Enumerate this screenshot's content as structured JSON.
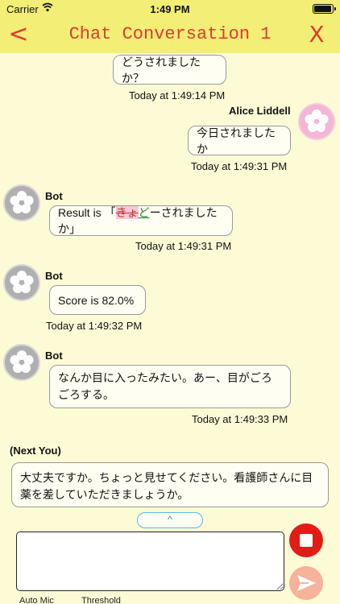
{
  "status_bar": {
    "carrier": "Carrier",
    "time": "1:49 PM",
    "battery_level": 0.95
  },
  "nav": {
    "back": "<",
    "title": "Chat Conversation 1",
    "close": "X"
  },
  "messages": [
    {
      "text": "どうされましたか？",
      "timestamp": "Today at 1:49:14 PM"
    },
    {
      "sender": "Alice Liddell",
      "text": "今日されましたか",
      "timestamp": "Today at 1:49:31 PM"
    },
    {
      "sender": "Bot",
      "prefix": "Result is 「",
      "struck": "きょ",
      "inserted": "ど",
      "suffix": "ーされましたか」",
      "timestamp": "Today at 1:49:31 PM"
    },
    {
      "sender": "Bot",
      "text": "Score is 82.0%",
      "timestamp": "Today at 1:49:32 PM"
    },
    {
      "sender": "Bot",
      "text": "なんか目に入ったみたい。あー、目がごろごろする。",
      "timestamp": "Today at 1:49:33 PM"
    }
  ],
  "next_you": {
    "label": "(Next You)",
    "text": "大丈夫ですか。ちょっと見せてください。看護師さんに目薬を差していただきましょうか。"
  },
  "expand_button": "^",
  "input": {
    "value": ""
  },
  "bottom_labels": {
    "auto_mic": "Auto Mic",
    "threshold": "Threshold"
  },
  "colors": {
    "nav_bar": "#f2ee76",
    "background": "#fdfbd6",
    "accent_red": "#e03a2f",
    "stop": "#e21b17",
    "send": "#f6b29b"
  },
  "icons": [
    "back-chevron-icon",
    "close-icon",
    "wifi-icon",
    "battery-icon",
    "flower-avatar-icon",
    "stop-icon",
    "send-icon"
  ]
}
